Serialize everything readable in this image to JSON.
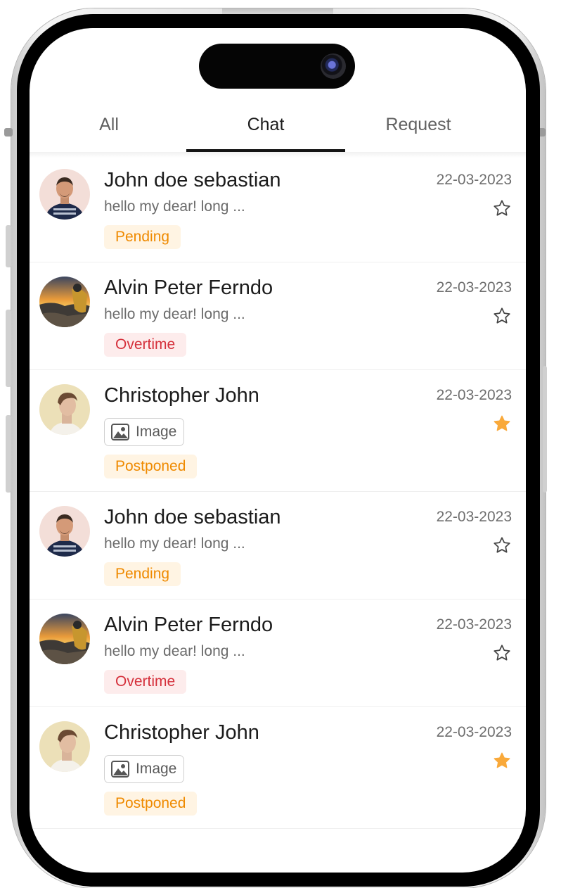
{
  "tabs": [
    {
      "label": "All"
    },
    {
      "label": "Chat"
    },
    {
      "label": "Request"
    }
  ],
  "active_tab": "Chat",
  "colors": {
    "pending": "#ef8a00",
    "overtime": "#d5303b",
    "star_filled": "#f9a93a",
    "star_outline": "#444444"
  },
  "conversations": [
    {
      "name": "John doe sebastian",
      "preview": "hello my dear! long ...",
      "date": "22-03-2023",
      "status": "Pending",
      "starred": false,
      "avatar": "man-striped-shirt-avatar"
    },
    {
      "name": "Alvin Peter Ferndo",
      "preview": "hello my dear! long ...",
      "date": "22-03-2023",
      "status": "Overtime",
      "starred": false,
      "avatar": "sunset-hiker-avatar"
    },
    {
      "name": "Christopher John",
      "preview": "Image",
      "date": "22-03-2023",
      "status": "Postponed",
      "starred": true,
      "avatar": "man-profile-avatar",
      "attachment": "image"
    },
    {
      "name": "John doe sebastian",
      "preview": "hello my dear! long ...",
      "date": "22-03-2023",
      "status": "Pending",
      "starred": false,
      "avatar": "man-striped-shirt-avatar"
    },
    {
      "name": "Alvin Peter Ferndo",
      "preview": "hello my dear! long ...",
      "date": "22-03-2023",
      "status": "Overtime",
      "starred": false,
      "avatar": "sunset-hiker-avatar"
    },
    {
      "name": "Christopher John",
      "preview": "Image",
      "date": "22-03-2023",
      "status": "Postponed",
      "starred": true,
      "avatar": "man-profile-avatar",
      "attachment": "image"
    }
  ]
}
